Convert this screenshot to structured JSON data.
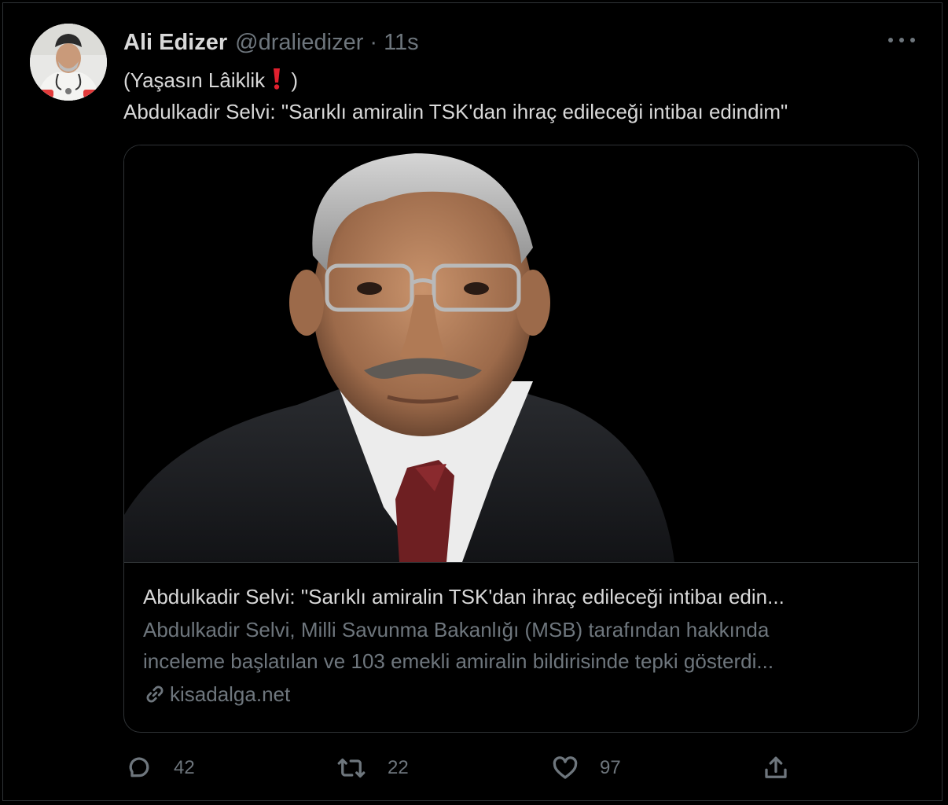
{
  "tweet": {
    "author": {
      "display_name": "Ali Edizer",
      "handle": "@draliedizer",
      "separator": "·",
      "time": "11s"
    },
    "text": {
      "line1_start": "(Yaşasın Lâiklik",
      "line1_end": ")",
      "line2": "Abdulkadir Selvi: \"Sarıklı amiralin TSK'dan ihraç edileceği intibaı edindim\""
    },
    "card": {
      "title": "Abdulkadir Selvi: \"Sarıklı amiralin TSK'dan ihraç edileceği intibaı edin...",
      "description_line1": "Abdulkadir Selvi, Milli Savunma Bakanlığı (MSB) tarafından hakkında",
      "description_line2": "inceleme başlatılan ve 103 emekli amiralin bildirisinde tepki gösterdi...",
      "domain": "kisadalga.net"
    },
    "actions": {
      "reply_count": "42",
      "retweet_count": "22",
      "like_count": "97"
    }
  },
  "colors": {
    "background": "#000000",
    "primary_text": "#D9D9D9",
    "secondary_text": "#6E767D",
    "border": "#2F3336",
    "exclamation": "#E0202E"
  },
  "icons": {
    "more": "more-horizontal-icon",
    "emoji": "red-exclamation-emoji",
    "link": "link-icon",
    "reply": "reply-bubble-icon",
    "retweet": "retweet-icon",
    "like": "heart-icon",
    "share": "share-upload-icon"
  }
}
